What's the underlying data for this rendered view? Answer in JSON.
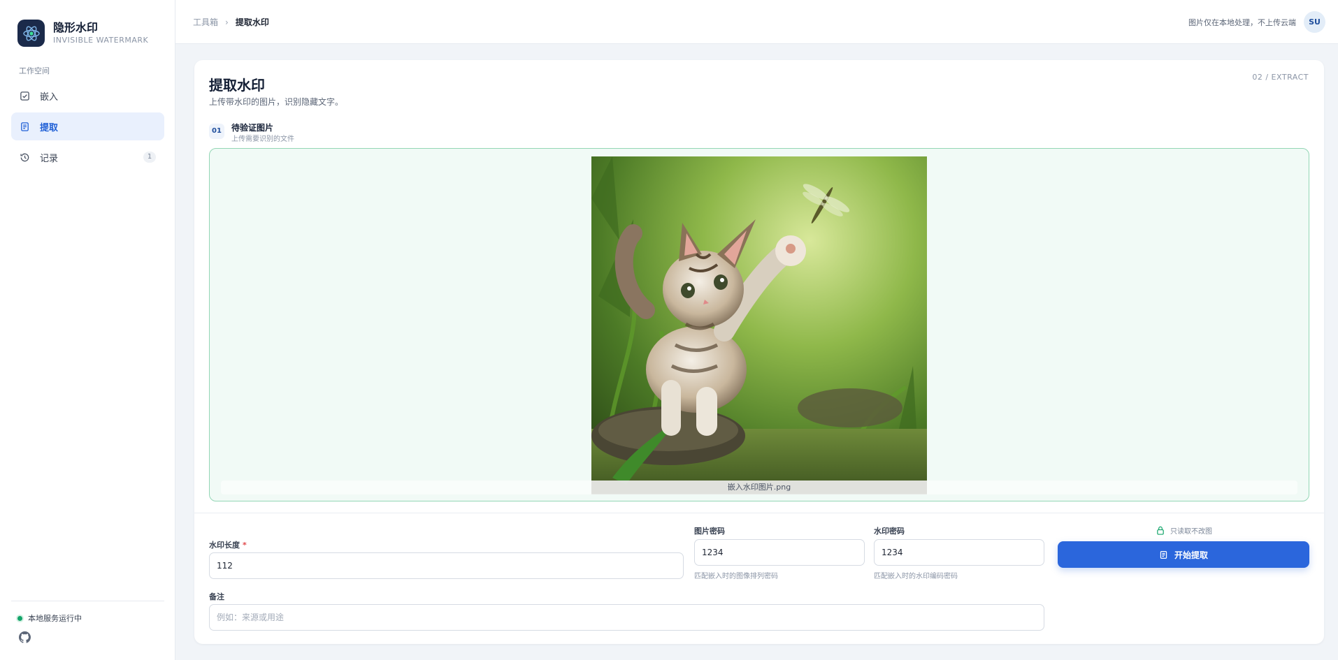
{
  "brand": {
    "title": "隐形水印",
    "subtitle": "INVISIBLE WATERMARK"
  },
  "sidebar": {
    "section_label": "工作空间",
    "items": [
      {
        "label": "嵌入",
        "icon": "check-square-icon"
      },
      {
        "label": "提取",
        "icon": "document-icon",
        "active": true
      },
      {
        "label": "记录",
        "icon": "history-icon",
        "count": "1"
      }
    ],
    "status": "本地服务运行中"
  },
  "topbar": {
    "breadcrumb_root": "工具箱",
    "breadcrumb_current": "提取水印",
    "note": "图片仅在本地处理，不上传云端",
    "avatar": "SU"
  },
  "page": {
    "title": "提取水印",
    "subtitle": "上传带水印的图片，识别隐藏文字。",
    "tag": "02 / EXTRACT"
  },
  "step": {
    "num": "01",
    "title": "待验证图片",
    "subtitle": "上传需要识别的文件"
  },
  "upload": {
    "filename": "嵌入水印图片.png"
  },
  "form": {
    "length_label": "水印长度",
    "length_required": "*",
    "length_value": "112",
    "img_pwd_label": "图片密码",
    "img_pwd_value": "1234",
    "img_pwd_hint": "匹配嵌入时的图像排列密码",
    "wm_pwd_label": "水印密码",
    "wm_pwd_value": "1234",
    "wm_pwd_hint": "匹配嵌入时的水印编码密码",
    "note_label": "备注",
    "note_placeholder": "例如：来源或用途"
  },
  "action": {
    "readonly_note": "只读取不改图",
    "button_label": "开始提取"
  },
  "colors": {
    "accent": "#2b66dc",
    "success": "#13a46a",
    "brand_dark": "#1b2a4a"
  }
}
